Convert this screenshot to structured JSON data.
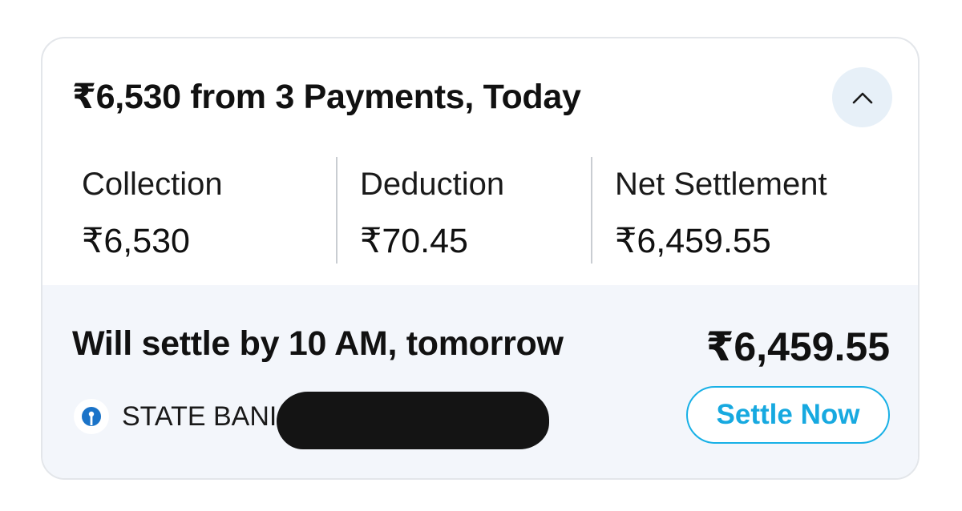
{
  "summary": {
    "title": "₹6,530 from 3 Payments, Today",
    "collapse_icon": "chevron-up-icon"
  },
  "stats": [
    {
      "label": "Collection",
      "value": "₹6,530"
    },
    {
      "label": "Deduction",
      "value": "₹70.45"
    },
    {
      "label": "Net Settlement",
      "value": "₹6,459.55"
    }
  ],
  "settlement": {
    "text": "Will settle by 10 AM, tomorrow",
    "amount": "₹6,459.55",
    "bank_name": "STATE BANI",
    "bank_icon": "sbi-logo-icon",
    "button_label": "Settle Now",
    "button_color": "#17b0e6"
  }
}
